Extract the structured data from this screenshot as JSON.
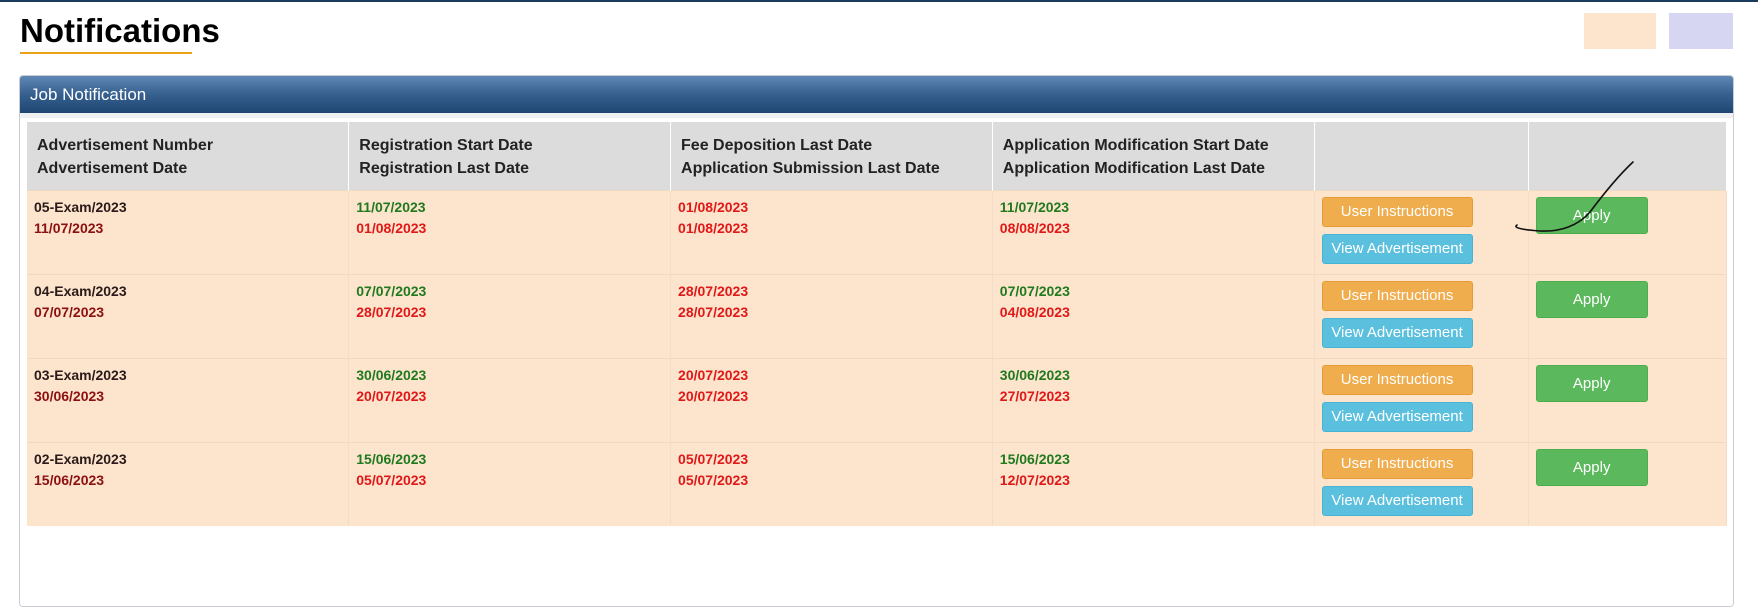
{
  "page": {
    "title": "Notifications"
  },
  "panel": {
    "title": "Job Notification"
  },
  "table": {
    "headers": [
      {
        "line1": "Advertisement Number",
        "line2": "Advertisement Date"
      },
      {
        "line1": "Registration Start Date",
        "line2": "Registration Last Date"
      },
      {
        "line1": "Fee Deposition Last Date",
        "line2": "Application Submission Last Date"
      },
      {
        "line1": "Application Modification Start Date",
        "line2": "Application Modification Last Date"
      },
      {
        "line1": "",
        "line2": ""
      },
      {
        "line1": "",
        "line2": ""
      }
    ],
    "rows": [
      {
        "adv_number": "05-Exam/2023",
        "adv_date": "11/07/2023",
        "reg_start": "11/07/2023",
        "reg_last": "01/08/2023",
        "fee_last": "01/08/2023",
        "submission_last": "01/08/2023",
        "mod_start": "11/07/2023",
        "mod_last": "08/08/2023"
      },
      {
        "adv_number": "04-Exam/2023",
        "adv_date": "07/07/2023",
        "reg_start": "07/07/2023",
        "reg_last": "28/07/2023",
        "fee_last": "28/07/2023",
        "submission_last": "28/07/2023",
        "mod_start": "07/07/2023",
        "mod_last": "04/08/2023"
      },
      {
        "adv_number": "03-Exam/2023",
        "adv_date": "30/06/2023",
        "reg_start": "30/06/2023",
        "reg_last": "20/07/2023",
        "fee_last": "20/07/2023",
        "submission_last": "20/07/2023",
        "mod_start": "30/06/2023",
        "mod_last": "27/07/2023"
      },
      {
        "adv_number": "02-Exam/2023",
        "adv_date": "15/06/2023",
        "reg_start": "15/06/2023",
        "reg_last": "05/07/2023",
        "fee_last": "05/07/2023",
        "submission_last": "05/07/2023",
        "mod_start": "15/06/2023",
        "mod_last": "12/07/2023"
      }
    ]
  },
  "buttons": {
    "user_instructions": "User Instructions",
    "view_advertisement": "View Advertisement",
    "apply": "Apply"
  },
  "colors": {
    "row_background": "#fde4cd",
    "header_background": "#dcdcdc",
    "start_date": "#1f7a1f",
    "last_date": "#e01818",
    "instructions_button": "#f0ad4e",
    "view_button": "#5bc0de",
    "apply_button": "#5cb85c",
    "legend_peach": "#fde4cd",
    "legend_lavender": "#d6d6f2",
    "panel_header": "#36608f"
  }
}
